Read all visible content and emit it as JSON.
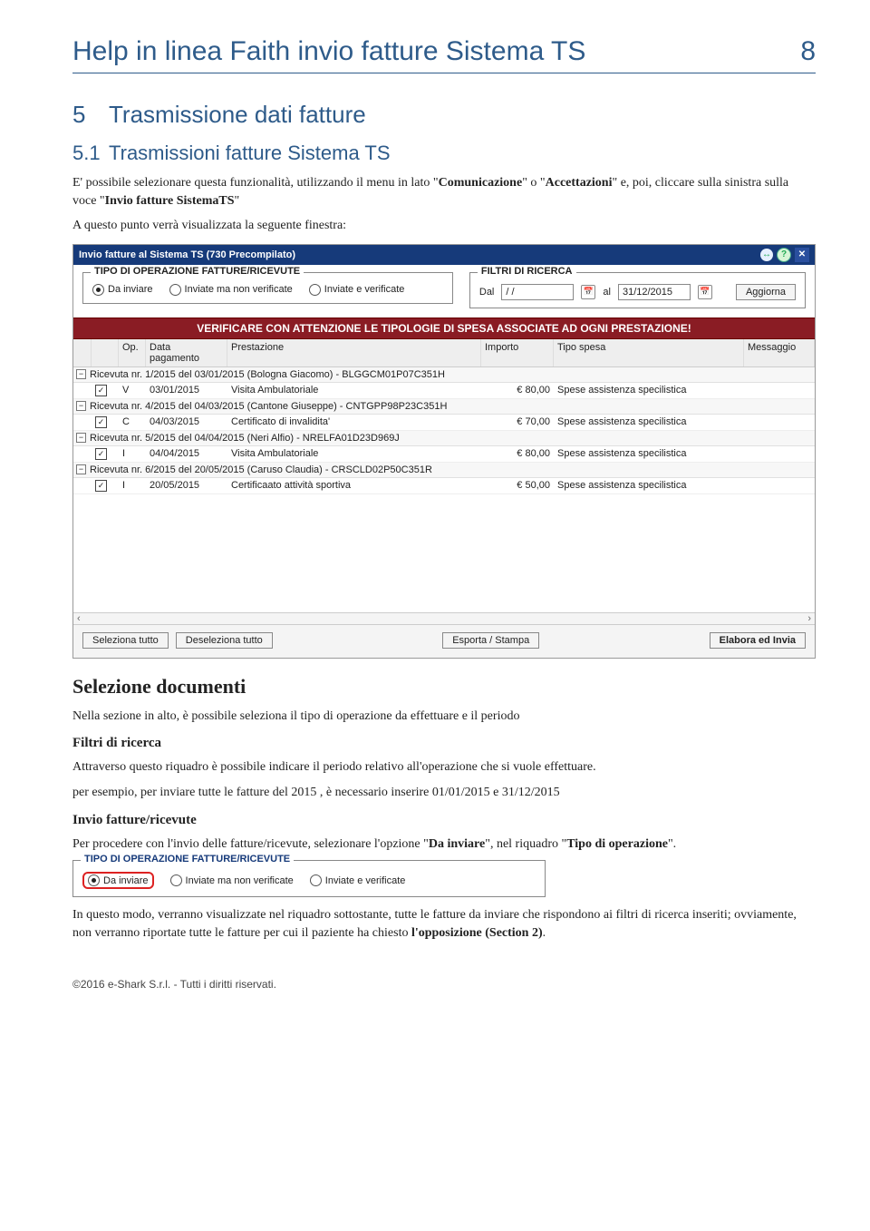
{
  "header": {
    "title": "Help in linea Faith invio fatture Sistema TS",
    "page_number": "8"
  },
  "sec5": {
    "num": "5",
    "title": "Trasmissione dati fatture"
  },
  "sec51": {
    "num": "5.1",
    "title": "Trasmissioni fatture Sistema TS",
    "intro_pre": "E' possibile selezionare questa funzionalità, utilizzando il menu in lato \"",
    "intro_b1": "Comunicazione",
    "intro_mid1": "\" o \"",
    "intro_b2": "Accettazioni",
    "intro_mid2": "\" e, poi, cliccare  sulla sinistra sulla voce \"",
    "intro_b3": "Invio fatture SistemaTS",
    "intro_end": "\"",
    "line2": "A questo punto verrà visualizzata la seguente finestra:"
  },
  "window": {
    "title": "Invio fatture al Sistema TS (730 Precompilato)",
    "tipo_legend": "TIPO DI OPERAZIONE FATTURE/RICEVUTE",
    "radio1": "Da inviare",
    "radio2": "Inviate ma non verificate",
    "radio3": "Inviate e verificate",
    "filtri_legend": "FILTRI DI RICERCA",
    "lbl_dal": "Dal",
    "val_dal": "/ /",
    "lbl_al": "al",
    "val_al": "31/12/2015",
    "btn_aggiorna": "Aggiorna",
    "warning": "VERIFICARE CON ATTENZIONE LE TIPOLOGIE DI SPESA ASSOCIATE AD OGNI PRESTAZIONE!",
    "cols": {
      "c1": "",
      "c2": "",
      "c3": "Op.",
      "c4": "Data pagamento",
      "c5": "Prestazione",
      "c6": "Importo",
      "c7": "Tipo spesa",
      "c8": "Messaggio"
    },
    "groups": [
      {
        "label": "Ricevuta nr. 1/2015 del 03/01/2015 (Bologna Giacomo) - BLGGCM01P07C351H",
        "row": {
          "op": "V",
          "data": "03/01/2015",
          "prest": "Visita Ambulatoriale",
          "imp": "€ 80,00",
          "tipo": "Spese assistenza specilistica"
        }
      },
      {
        "label": "Ricevuta nr. 4/2015 del 04/03/2015 (Cantone Giuseppe) - CNTGPP98P23C351H",
        "row": {
          "op": "C",
          "data": "04/03/2015",
          "prest": "Certificato di invalidita'",
          "imp": "€ 70,00",
          "tipo": "Spese assistenza specilistica"
        }
      },
      {
        "label": "Ricevuta nr. 5/2015 del 04/04/2015 (Neri Alfio) - NRELFA01D23D969J",
        "row": {
          "op": "I",
          "data": "04/04/2015",
          "prest": "Visita Ambulatoriale",
          "imp": "€ 80,00",
          "tipo": "Spese assistenza specilistica"
        }
      },
      {
        "label": "Ricevuta nr. 6/2015 del 20/05/2015 (Caruso Claudia) - CRSCLD02P50C351R",
        "row": {
          "op": "I",
          "data": "20/05/2015",
          "prest": "Certificaato attività sportiva",
          "imp": "€ 50,00",
          "tipo": "Spese assistenza specilistica"
        }
      }
    ],
    "btn_sel_tutto": "Seleziona tutto",
    "btn_desel_tutto": "Deseleziona tutto",
    "btn_esporta": "Esporta / Stampa",
    "btn_elabora": "Elabora ed Invia"
  },
  "selezione": {
    "title": "Selezione documenti",
    "p1": "Nella sezione in alto, è possibile seleziona il tipo di operazione da effettuare e il periodo",
    "h_filtri": "Filtri di ricerca",
    "p2": "Attraverso questo riquadro è possibile indicare il periodo relativo all'operazione che si vuole effettuare.",
    "p3": "per esempio, per inviare tutte le fatture del 2015 , è necessario inserire  01/01/2015 e 31/12/2015",
    "h_invio": "Invio fatture/ricevute",
    "p4_pre": "Per procedere con l'invio delle fatture/ricevute, selezionare l'opzione \"",
    "p4_b1": "Da inviare",
    "p4_mid": "\", nel riquadro \"",
    "p4_b2": "Tipo di operazione",
    "p4_end": "\".",
    "p5_pre": "In questo modo, verranno visualizzate nel riquadro sottostante, tutte le fatture da inviare che rispondono ai filtri di ricerca inseriti; ovviamente, non verranno riportate tutte le fatture per cui il paziente ha chiesto ",
    "p5_b": "l'opposizione (Section 2)",
    "p5_end": "."
  },
  "small": {
    "legend": "TIPO DI OPERAZIONE FATTURE/RICEVUTE",
    "r1": "Da inviare",
    "r2": "Inviate ma non verificate",
    "r3": "Inviate e verificate"
  },
  "footer": "©2016 e-Shark S.r.l. - Tutti i diritti riservati."
}
